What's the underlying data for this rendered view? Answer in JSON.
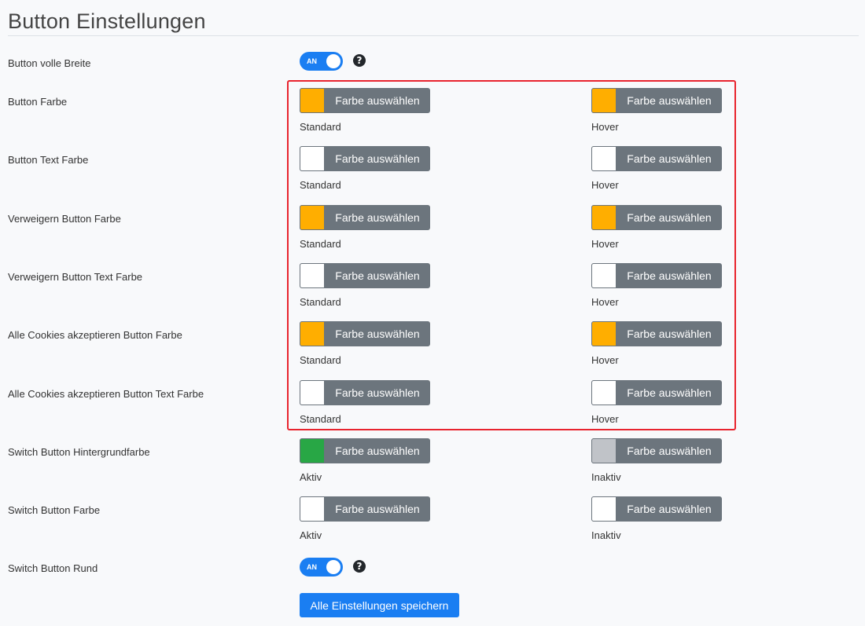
{
  "page": {
    "title": "Button Einstellungen",
    "save_label": "Alle Einstellungen speichern"
  },
  "toggles": {
    "full_width": {
      "label": "Button volle Breite",
      "state": "AN",
      "help": "?"
    },
    "switch_round": {
      "label": "Switch Button Rund",
      "state": "AN",
      "help": "?"
    }
  },
  "picker_label": "Farbe auswählen",
  "color_rows": [
    {
      "label": "Button Farbe",
      "left": {
        "color": "#ffae00",
        "caption": "Standard"
      },
      "right": {
        "color": "#ffae00",
        "caption": "Hover"
      }
    },
    {
      "label": "Button Text Farbe",
      "left": {
        "color": "#ffffff",
        "caption": "Standard"
      },
      "right": {
        "color": "#ffffff",
        "caption": "Hover"
      }
    },
    {
      "label": "Verweigern Button Farbe",
      "left": {
        "color": "#ffae00",
        "caption": "Standard"
      },
      "right": {
        "color": "#ffae00",
        "caption": "Hover"
      }
    },
    {
      "label": "Verweigern Button Text Farbe",
      "left": {
        "color": "#ffffff",
        "caption": "Standard"
      },
      "right": {
        "color": "#ffffff",
        "caption": "Hover"
      }
    },
    {
      "label": "Alle Cookies akzeptieren Button Farbe",
      "left": {
        "color": "#ffae00",
        "caption": "Standard"
      },
      "right": {
        "color": "#ffae00",
        "caption": "Hover"
      }
    },
    {
      "label": "Alle Cookies akzeptieren Button Text Farbe",
      "left": {
        "color": "#ffffff",
        "caption": "Standard"
      },
      "right": {
        "color": "#ffffff",
        "caption": "Hover"
      }
    },
    {
      "label": "Switch Button Hintergrundfarbe",
      "left": {
        "color": "#28a745",
        "caption": "Aktiv"
      },
      "right": {
        "color": "#c0c3c8",
        "caption": "Inaktiv"
      }
    },
    {
      "label": "Switch Button Farbe",
      "left": {
        "color": "#ffffff",
        "caption": "Aktiv"
      },
      "right": {
        "color": "#ffffff",
        "caption": "Inaktiv"
      }
    }
  ],
  "icons": {
    "help": "question-circle-icon"
  }
}
